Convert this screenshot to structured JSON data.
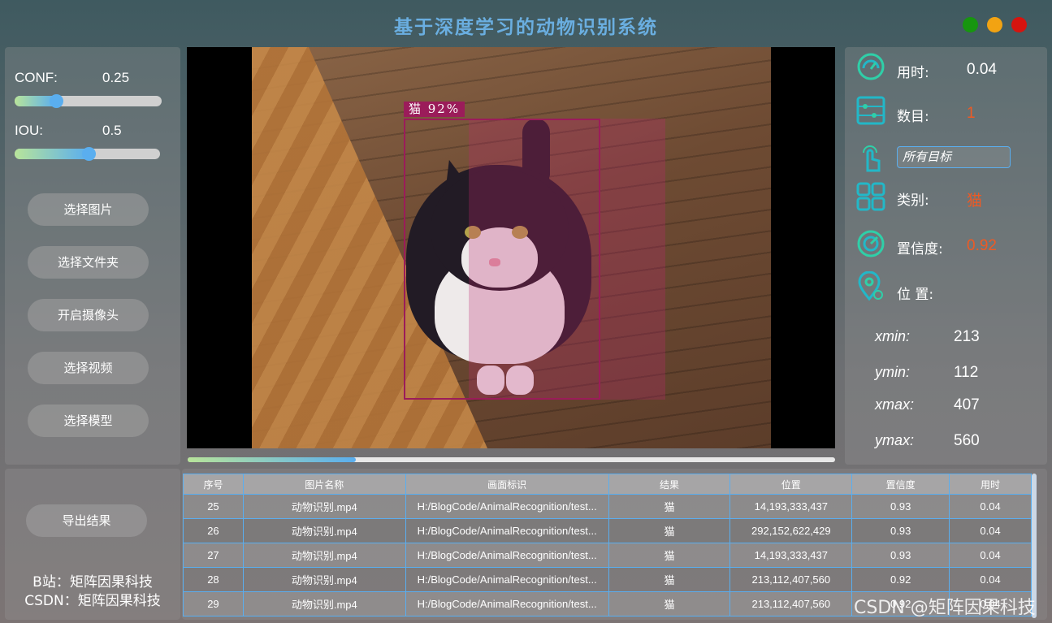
{
  "window": {
    "title": "基于深度学习的动物识别系统",
    "controls": {
      "green": "#17960f",
      "yellow": "#f2a312",
      "red": "#d6140f"
    }
  },
  "params": {
    "conf_label": "CONF:",
    "conf_value": "0.25",
    "conf_fraction": 0.25,
    "iou_label": "IOU:",
    "iou_value": "0.5",
    "iou_fraction": 0.5
  },
  "buttons": {
    "select_image": "选择图片",
    "select_folder": "选择文件夹",
    "open_camera": "开启摄像头",
    "select_video": "选择视频",
    "select_model": "选择模型",
    "export_results": "导出结果"
  },
  "detection": {
    "label": "猫  92%"
  },
  "playback": {
    "progress_fraction": 0.26
  },
  "info": {
    "time_label": "用时:",
    "time_value": "0.04",
    "count_label": "数目:",
    "count_value": "1",
    "target_select": "所有目标",
    "class_label": "类别:",
    "class_value": "猫",
    "confidence_label": "置信度:",
    "confidence_value": "0.92",
    "position_label": "位 置:",
    "xmin_label": "xmin:",
    "xmin_value": "213",
    "ymin_label": "ymin:",
    "ymin_value": "112",
    "xmax_label": "xmax:",
    "xmax_value": "407",
    "ymax_label": "ymax:",
    "ymax_value": "560"
  },
  "credits": {
    "bilibili": "B站：矩阵因果科技",
    "csdn": "CSDN：矩阵因果科技",
    "watermark": "CSDN @矩阵因果科技"
  },
  "table": {
    "headers": [
      "序号",
      "图片名称",
      "画面标识",
      "结果",
      "位置",
      "置信度",
      "用时"
    ],
    "rows": [
      [
        "25",
        "动物识别.mp4",
        "H:/BlogCode/AnimalRecognition/test...",
        "猫",
        "14,193,333,437",
        "0.93",
        "0.04"
      ],
      [
        "26",
        "动物识别.mp4",
        "H:/BlogCode/AnimalRecognition/test...",
        "猫",
        "292,152,622,429",
        "0.93",
        "0.04"
      ],
      [
        "27",
        "动物识别.mp4",
        "H:/BlogCode/AnimalRecognition/test...",
        "猫",
        "14,193,333,437",
        "0.93",
        "0.04"
      ],
      [
        "28",
        "动物识别.mp4",
        "H:/BlogCode/AnimalRecognition/test...",
        "猫",
        "213,112,407,560",
        "0.92",
        "0.04"
      ],
      [
        "29",
        "动物识别.mp4",
        "H:/BlogCode/AnimalRecognition/test...",
        "猫",
        "213,112,407,560",
        "0.92",
        "0.04"
      ]
    ]
  },
  "colors": {
    "accent_blue": "#5aaeef",
    "value_orange": "#ee5a24",
    "box_magenta": "#9b1c5a",
    "icon_teal": "#22b8c8"
  }
}
